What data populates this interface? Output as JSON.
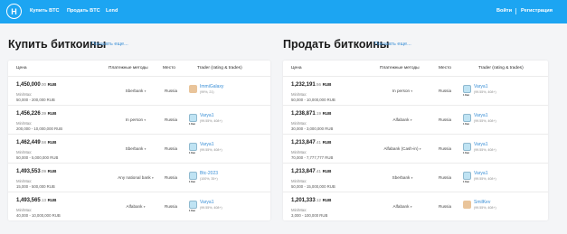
{
  "header": {
    "logo_glyph": "H",
    "nav": [
      "Купить BTC",
      "Продать BTC",
      "Lend"
    ],
    "login": "Войти",
    "register": "Регистрация",
    "bg_color": "#1ca5f2"
  },
  "buy": {
    "title": "Купить биткоины",
    "show_more": "Показать еще...",
    "columns": [
      "Цена",
      "Платежные методы",
      "Место",
      "Trader (rating & trades)"
    ],
    "rows": [
      {
        "price": "1,450,000",
        "dec": ".00",
        "cur": "RUB",
        "minmax": "Min/Max:",
        "range": "50,000 - 200,000 RUB",
        "method": "Sberbank",
        "location": "Russia",
        "trader": "ImmiGalaxy",
        "stats": "(99%, 21)",
        "avatar": "photo"
      },
      {
        "price": "1,456,226",
        "dec": ".39",
        "cur": "RUB",
        "minmax": "Min/Max:",
        "range": "200,000 - 10,000,000 RUB",
        "method": "In person",
        "location": "Russia",
        "trader": "Varya1",
        "stats": "(99.55%, 408+)",
        "avatar": "tile",
        "badge": "1 Kan"
      },
      {
        "price": "1,462,449",
        "dec": ".58",
        "cur": "RUB",
        "minmax": "Min/Max:",
        "range": "50,000 - 5,000,000 RUB",
        "method": "Sberbank",
        "location": "Russia",
        "trader": "Varya1",
        "stats": "(99.55%, 408+)",
        "avatar": "tile",
        "badge": "1 Kan"
      },
      {
        "price": "1,493,553",
        "dec": ".09",
        "cur": "RUB",
        "minmax": "Min/Max:",
        "range": "15,000 - 500,000 RUB",
        "method": "Any national bank",
        "location": "Russia",
        "trader": "Btc-2023",
        "stats": "(100%, 35+)",
        "avatar": "tile",
        "badge": "1 Kan"
      },
      {
        "price": "1,493,565",
        "dec": ".13",
        "cur": "RUB",
        "minmax": "Min/Max:",
        "range": "40,000 - 10,000,000 RUB",
        "method": "Alfabank",
        "location": "Russia",
        "trader": "Varya1",
        "stats": "(99.55%, 408+)",
        "avatar": "tile",
        "badge": "1 Kan"
      }
    ]
  },
  "sell": {
    "title": "Продать биткоины",
    "show_more": "Показать еще...",
    "columns": [
      "Цена",
      "Платежные методы",
      "Место",
      "Trader (rating & trades)"
    ],
    "rows": [
      {
        "price": "1,232,191",
        "dec": ".56",
        "cur": "RUB",
        "minmax": "Min/Max:",
        "range": "50,000 - 10,000,000 RUB",
        "method": "In person",
        "location": "Russia",
        "trader": "Varya1",
        "stats": "(99.55%, 408+)",
        "avatar": "tile",
        "badge": "1 Kan"
      },
      {
        "price": "1,238,871",
        "dec": ".19",
        "cur": "RUB",
        "minmax": "Min/Max:",
        "range": "30,000 - 3,000,000 RUB",
        "method": "Alfabank",
        "location": "Russia",
        "trader": "Varya1",
        "stats": "(99.55%, 408+)",
        "avatar": "tile",
        "badge": "1 Kan"
      },
      {
        "price": "1,213,847",
        "dec": ".41",
        "cur": "RUB",
        "minmax": "Min/Max:",
        "range": "70,000 - 7,777,777 RUB",
        "method": "Alfabank (Cash-in)",
        "location": "Russia",
        "trader": "Varya1",
        "stats": "(99.55%, 408+)",
        "avatar": "tile",
        "badge": "1 Kan"
      },
      {
        "price": "1,213,847",
        "dec": ".41",
        "cur": "RUB",
        "minmax": "Min/Max:",
        "range": "50,000 - 15,000,000 RUB",
        "method": "Sberbank",
        "location": "Russia",
        "trader": "Varya1",
        "stats": "(99.55%, 408+)",
        "avatar": "tile",
        "badge": "1 Kan"
      },
      {
        "price": "1,201,333",
        "dec": ".12",
        "cur": "RUB",
        "minmax": "Min/Max:",
        "range": "3,000 - 100,000 RUB",
        "method": "Alfabank",
        "location": "Russia",
        "trader": "SmilKev",
        "stats": "(99.55%, 408+)",
        "avatar": "photo"
      }
    ]
  }
}
